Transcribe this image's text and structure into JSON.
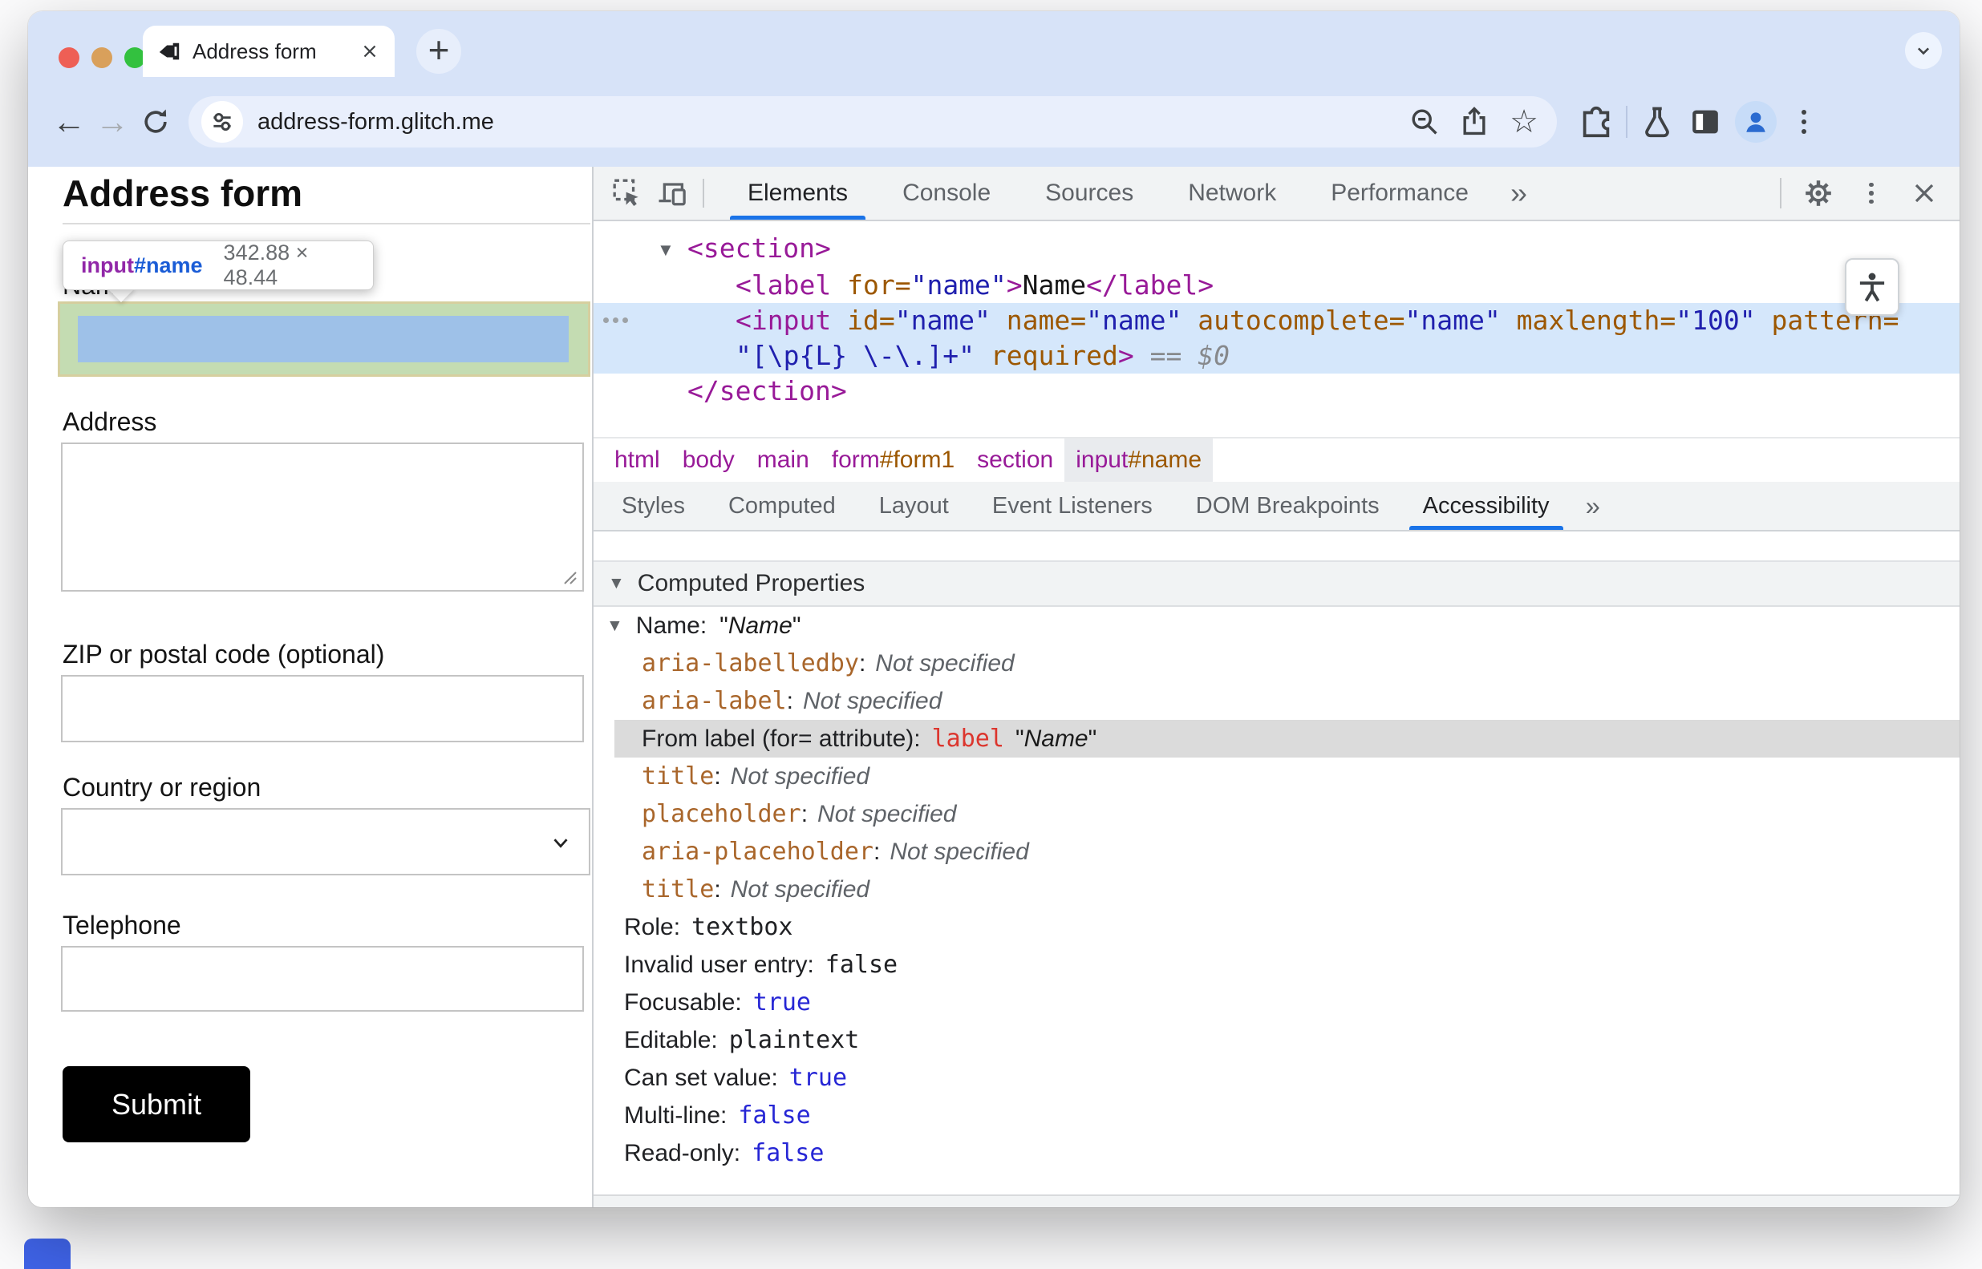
{
  "browser": {
    "tab_title": "Address form",
    "url": "address-form.glitch.me"
  },
  "icons": {
    "back": "←",
    "forward": "→",
    "star": "☆",
    "new_tab": "+",
    "more_tabs": "››",
    "more_subtabs": "››",
    "expanded_arrow": "▼"
  },
  "page": {
    "heading": "Address form",
    "tooltip": {
      "element": "input",
      "id": "#name",
      "size": "342.88 × 48.44"
    },
    "fields": {
      "name_label": "Name",
      "address_label": "Address",
      "zip_label": "ZIP or postal code (optional)",
      "country_label": "Country or region",
      "phone_label": "Telephone"
    },
    "submit_label": "Submit"
  },
  "devtools": {
    "main_tabs": [
      "Elements",
      "Console",
      "Sources",
      "Network",
      "Performance"
    ],
    "active_main_tab": "Elements",
    "tree": {
      "lines": [
        {
          "depth": 1,
          "parts": [
            [
              [
                "arrow",
                "▼"
              ],
              [
                "p",
                "<"
              ],
              [
                "tag",
                "section"
              ],
              [
                "p",
                ">"
              ]
            ]
          ]
        },
        {
          "depth": 2,
          "parts": [
            [
              [
                "p",
                "<"
              ],
              [
                "tag",
                "label"
              ],
              [
                "plain",
                " "
              ],
              [
                "attr",
                "for="
              ],
              [
                "val",
                "\"name\""
              ],
              [
                "p",
                ">"
              ],
              [
                "text",
                "Name"
              ],
              [
                "p",
                "</"
              ],
              [
                "tag",
                "label"
              ],
              [
                "p",
                ">"
              ]
            ]
          ]
        },
        {
          "depth": 2,
          "selected": true,
          "parts": [
            [
              [
                "p",
                "<"
              ],
              [
                "tag",
                "input"
              ],
              [
                "plain",
                " "
              ],
              [
                "attr",
                "id="
              ],
              [
                "val",
                "\"name\""
              ],
              [
                "plain",
                " "
              ],
              [
                "attr",
                "name="
              ],
              [
                "val",
                "\"name\""
              ],
              [
                "plain",
                " "
              ],
              [
                "attr",
                "autocomplete="
              ],
              [
                "val",
                "\"name\""
              ],
              [
                "plain",
                " "
              ],
              [
                "attr",
                "maxlength="
              ],
              [
                "val",
                "\"100\""
              ],
              [
                "plain",
                " "
              ],
              [
                "attr",
                "pattern="
              ]
            ],
            [
              [
                "val",
                "\"[\\p{L} \\-\\.]+\""
              ],
              [
                "plain",
                " "
              ],
              [
                "attr",
                "required"
              ],
              [
                "p",
                ">"
              ],
              [
                "eq",
                " == "
              ],
              [
                "var",
                "$0"
              ]
            ]
          ]
        },
        {
          "depth": 1,
          "parts": [
            [
              [
                "p",
                "</"
              ],
              [
                "tag",
                "section"
              ],
              [
                "p",
                ">"
              ]
            ]
          ]
        }
      ]
    },
    "breadcrumbs": [
      {
        "tag": "html"
      },
      {
        "tag": "body"
      },
      {
        "tag": "main"
      },
      {
        "tag": "form",
        "id": "#form1"
      },
      {
        "tag": "section"
      },
      {
        "tag": "input",
        "id": "#name",
        "selected": true
      }
    ],
    "subtabs": [
      "Styles",
      "Computed",
      "Layout",
      "Event Listeners",
      "DOM Breakpoints",
      "Accessibility"
    ],
    "active_subtab": "Accessibility",
    "accessibility": {
      "section_title": "Computed Properties",
      "name_property": {
        "label": "Name:",
        "value": "Name"
      },
      "sources": [
        {
          "name": "aria-labelledby",
          "value": "Not specified"
        },
        {
          "name": "aria-label",
          "value": "Not specified"
        },
        {
          "from_label": "From label (for= attribute):",
          "code": "label",
          "value": "Name",
          "highlighted": true
        },
        {
          "name": "title",
          "value": "Not specified"
        },
        {
          "name": "placeholder",
          "value": "Not specified"
        },
        {
          "name": "aria-placeholder",
          "value": "Not specified"
        },
        {
          "name": "title",
          "value": "Not specified"
        }
      ],
      "properties": [
        {
          "label": "Role:",
          "value": "textbox",
          "value_color": "dark"
        },
        {
          "label": "Invalid user entry:",
          "value": "false",
          "value_color": "dark"
        },
        {
          "label": "Focusable:",
          "value": "true",
          "value_color": "blue"
        },
        {
          "label": "Editable:",
          "value": "plaintext",
          "value_color": "dark"
        },
        {
          "label": "Can set value:",
          "value": "true",
          "value_color": "blue"
        },
        {
          "label": "Multi-line:",
          "value": "false",
          "value_color": "blue"
        },
        {
          "label": "Read-only:",
          "value": "false",
          "value_color": "blue"
        }
      ]
    }
  },
  "colors": {
    "accent_blue": "#1a73e8",
    "toolbar_blue": "#d7e3f8",
    "highlight_content_blue": "#9ec1e8",
    "highlight_padding_green": "#c4dcb2",
    "selected_node_blue": "#d5e7fb",
    "traffic_close": "#ee5f55",
    "traffic_minimize": "#d9a05b",
    "traffic_maximize": "#33c13f"
  }
}
